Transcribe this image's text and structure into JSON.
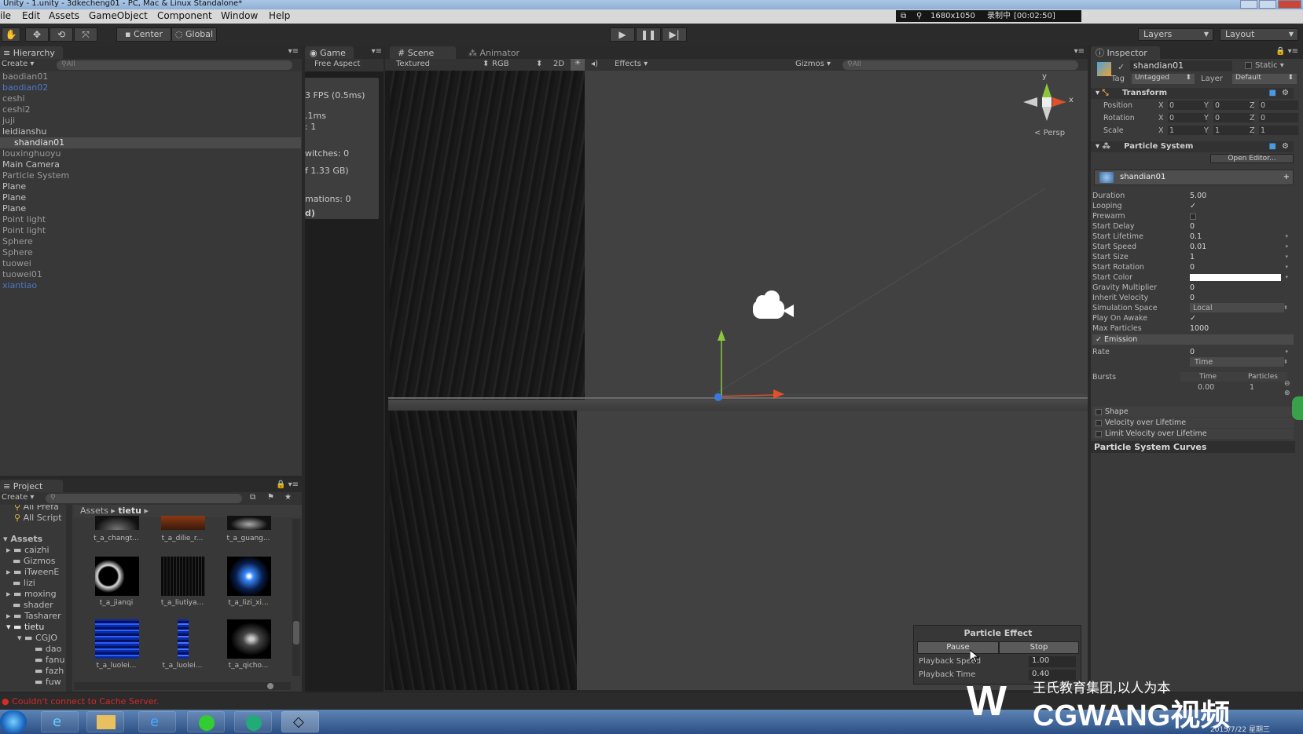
{
  "window": {
    "title": "Unity - 1.unity - 3dkecheng01 - PC, Mac & Linux Standalone*"
  },
  "menu": [
    "ile",
    "Edit",
    "Assets",
    "GameObject",
    "Component",
    "Window",
    "Help"
  ],
  "recorder": {
    "resolution": "1680x1050",
    "status": "录制中",
    "time": "[00:02:50]"
  },
  "toolbar": {
    "center_label": "Center",
    "global_label": "Global",
    "layers_label": "Layers",
    "layout_label": "Layout"
  },
  "hierarchy": {
    "title": "Hierarchy",
    "create_label": "Create",
    "search_placeholder": "All",
    "items": [
      "baodian01",
      "baodian02",
      "ceshi",
      "ceshi2",
      "juji",
      "leidianshu",
      "shandian01",
      "louxinghuoyu",
      "Main Camera",
      "Particle System",
      "Plane",
      "Plane",
      "Plane",
      "Point light",
      "Point light",
      "Sphere",
      "Sphere",
      "tuowei",
      "tuowei01",
      "xiantiao"
    ]
  },
  "game_view": {
    "tab": "Game",
    "aspect": "Free Aspect",
    "stats": [
      "3 FPS (0.5ms)",
      ".1ms",
      ": 1",
      "witches: 0",
      "f 1.33 GB)",
      "mations: 0",
      "d)"
    ]
  },
  "scene_view": {
    "tab": "Scene",
    "animator_tab": "Animator",
    "render_mode": "Textured",
    "color_mode": "RGB",
    "mode_2d": "2D",
    "effects": "Effects",
    "gizmos": "Gizmos",
    "search_placeholder": "All",
    "persp": "Persp",
    "axis_y": "y",
    "axis_x": "x"
  },
  "particle_effect": {
    "title": "Particle Effect",
    "pause": "Pause",
    "stop": "Stop",
    "speed_label": "Playback Speed",
    "speed_value": "1.00",
    "time_label": "Playback Time",
    "time_value": "0.40"
  },
  "project": {
    "title": "Project",
    "create_label": "Create",
    "favorites": [
      "All Prefa",
      "All Script"
    ],
    "tree": [
      "Assets",
      "caizhi",
      "Gizmos",
      "iTweenE",
      "lizi",
      "moxing",
      "shader",
      "Tasharer",
      "tietu",
      "CGJO",
      "dao",
      "fanu",
      "fazh",
      "fuw"
    ],
    "breadcrumb": [
      "Assets",
      "tietu"
    ],
    "assets": [
      "t_a_changt...",
      "t_a_dilie_r...",
      "t_a_guang...",
      "t_a_jianqi",
      "t_a_liutiya...",
      "t_a_lizi_xi...",
      "t_a_luolei...",
      "t_a_luolei...",
      "t_a_qicho..."
    ]
  },
  "inspector": {
    "title": "Inspector",
    "object_name": "shandian01",
    "static_label": "Static",
    "tag_label": "Tag",
    "tag_value": "Untagged",
    "layer_label": "Layer",
    "layer_value": "Default",
    "transform": {
      "title": "Transform",
      "rows": [
        {
          "label": "Position",
          "x": "0",
          "y": "0",
          "z": "0"
        },
        {
          "label": "Rotation",
          "x": "0",
          "y": "0",
          "z": "0"
        },
        {
          "label": "Scale",
          "x": "1",
          "y": "1",
          "z": "1"
        }
      ],
      "x": "X",
      "y": "Y",
      "z": "Z"
    },
    "particle_system": {
      "title": "Particle System",
      "open_editor": "Open Editor...",
      "module_name": "shandian01",
      "props": [
        {
          "label": "Duration",
          "value": "5.00"
        },
        {
          "label": "Looping",
          "value": "✓"
        },
        {
          "label": "Prewarm",
          "value": ""
        },
        {
          "label": "Start Delay",
          "value": "0"
        },
        {
          "label": "Start Lifetime",
          "value": "0.1"
        },
        {
          "label": "Start Speed",
          "value": "0.01"
        },
        {
          "label": "Start Size",
          "value": "1"
        },
        {
          "label": "Start Rotation",
          "value": "0"
        },
        {
          "label": "Start Color",
          "value": ""
        },
        {
          "label": "Gravity Multiplier",
          "value": "0"
        },
        {
          "label": "Inherit Velocity",
          "value": "0"
        },
        {
          "label": "Simulation Space",
          "value": "Local"
        },
        {
          "label": "Play On Awake",
          "value": "✓"
        },
        {
          "label": "Max Particles",
          "value": "1000"
        }
      ],
      "emission": "Emission",
      "rate_label": "Rate",
      "rate_value": "0",
      "rate_mode": "Time",
      "bursts_label": "Bursts",
      "bursts_time_header": "Time",
      "bursts_particles_header": "Particles",
      "bursts_time": "0.00",
      "bursts_particles": "1",
      "modules": [
        "Shape",
        "Velocity over Lifetime",
        "Limit Velocity over Lifetime"
      ],
      "curves": "Particle System Curves"
    }
  },
  "status": {
    "message": "Couldn't connect to Cache Server."
  },
  "watermark": {
    "line1": "王氏教育集团,以人为本",
    "brand": "CGWANG视频"
  },
  "tray": {
    "date": "2015/7/22 星期三"
  },
  "colors": {
    "accent_blue": "#4a78c8",
    "error_red": "#d42a2a",
    "gizmo_green": "#8cc63c",
    "gizmo_red": "#e0502a"
  }
}
